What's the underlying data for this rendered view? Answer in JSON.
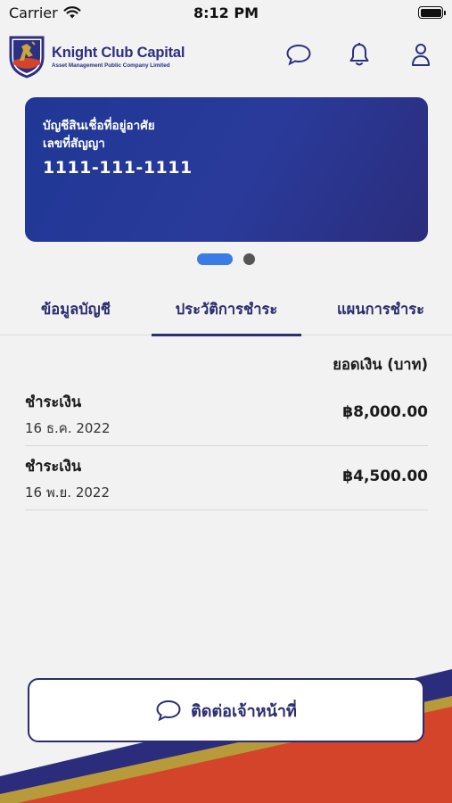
{
  "status_bar": {
    "carrier": "Carrier",
    "time": "8:12 PM"
  },
  "header": {
    "brand": "Knight Club Capital",
    "subtitle": "Asset Management Public Company Limited",
    "icons": [
      "chat-bubble-icon",
      "bell-icon",
      "user-icon"
    ]
  },
  "account_card": {
    "account_type": "บัญชีสินเชื่อที่อยู่อาศัย",
    "contract_label": "เลขที่สัญญา",
    "contract_number": "1111-111-1111"
  },
  "pager": {
    "pages": 2,
    "active_index": 0
  },
  "tabs": [
    {
      "label": "ข้อมูลบัญชี"
    },
    {
      "label": "ประวัติการชำระ"
    },
    {
      "label": "แผนการชำระ"
    }
  ],
  "active_tab": 1,
  "payments": {
    "column_header": "ยอดเงิน (บาท)",
    "rows": [
      {
        "title": "ชำระเงิน",
        "date": "16 ธ.ค. 2022",
        "amount": "฿8,000.00"
      },
      {
        "title": "ชำระเงิน",
        "date": "16 พ.ย. 2022",
        "amount": "฿4,500.00"
      }
    ]
  },
  "contact_button": {
    "label": "ติดต่อเจ้าหน้าที่"
  },
  "colors": {
    "primary": "#2b2d6e",
    "card": "#1f3796",
    "accent_blue": "#3a7be6",
    "deco_red": "#d4442a",
    "deco_gold": "#b89a3a",
    "background": "#f2f2f2"
  }
}
